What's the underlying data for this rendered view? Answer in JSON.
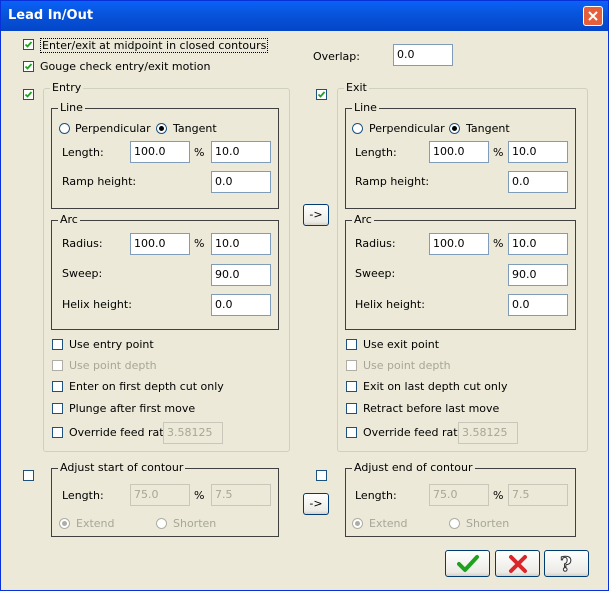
{
  "window": {
    "title": "Lead In/Out"
  },
  "options": {
    "midpoint_label": "Enter/exit at midpoint in closed contours",
    "midpoint_checked": true,
    "gouge_label": "Gouge check entry/exit motion",
    "gouge_checked": true,
    "overlap_label": "Overlap:",
    "overlap_value": "0.0"
  },
  "entry": {
    "title": "Entry",
    "checked": true,
    "line": {
      "title": "Line",
      "perpendicular_label": "Perpendicular",
      "tangent_label": "Tangent",
      "selected": "Tangent",
      "length_label": "Length:",
      "length_value": "100.0",
      "percent_symbol": "%",
      "length_abs_value": "10.0",
      "ramp_label": "Ramp height:",
      "ramp_value": "0.0"
    },
    "arc": {
      "title": "Arc",
      "radius_label": "Radius:",
      "radius_value": "100.0",
      "percent_symbol": "%",
      "radius_abs_value": "10.0",
      "sweep_label": "Sweep:",
      "sweep_value": "90.0",
      "helix_label": "Helix height:",
      "helix_value": "0.0"
    },
    "use_point_label": "Use entry point",
    "use_point_depth_label": "Use point depth",
    "depth_cut_label": "Enter on first depth cut only",
    "move_label": "Plunge after first move",
    "override_label": "Override feed rate",
    "override_value": "3.58125"
  },
  "exit": {
    "title": "Exit",
    "checked": true,
    "line": {
      "title": "Line",
      "perpendicular_label": "Perpendicular",
      "tangent_label": "Tangent",
      "selected": "Tangent",
      "length_label": "Length:",
      "length_value": "100.0",
      "percent_symbol": "%",
      "length_abs_value": "10.0",
      "ramp_label": "Ramp height:",
      "ramp_value": "0.0"
    },
    "arc": {
      "title": "Arc",
      "radius_label": "Radius:",
      "radius_value": "100.0",
      "percent_symbol": "%",
      "radius_abs_value": "10.0",
      "sweep_label": "Sweep:",
      "sweep_value": "90.0",
      "helix_label": "Helix height:",
      "helix_value": "0.0"
    },
    "use_point_label": "Use exit point",
    "use_point_depth_label": "Use point depth",
    "depth_cut_label": "Exit on last depth cut only",
    "move_label": "Retract before last move",
    "override_label": "Override feed rate",
    "override_value": "3.58125"
  },
  "copy_button_label": "->",
  "adjust_start": {
    "title": "Adjust start of contour",
    "length_label": "Length:",
    "length_value": "75.0",
    "percent_symbol": "%",
    "length_abs_value": "7.5",
    "extend_label": "Extend",
    "shorten_label": "Shorten",
    "selected": "Extend"
  },
  "adjust_end": {
    "title": "Adjust end of contour",
    "length_label": "Length:",
    "length_value": "75.0",
    "percent_symbol": "%",
    "length_abs_value": "7.5",
    "extend_label": "Extend",
    "shorten_label": "Shorten",
    "selected": "Extend"
  },
  "buttons": {
    "ok_icon": "green-checkmark-icon",
    "cancel_icon": "red-x-icon",
    "help_icon": "question-mark-icon"
  },
  "colors": {
    "title_bar": "#0A5BEF",
    "ok_green": "#1EA21E",
    "cancel_red": "#D9262A",
    "dialog_bg": "#ECE9D8"
  }
}
